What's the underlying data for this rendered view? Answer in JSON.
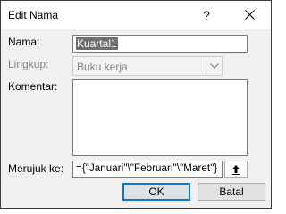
{
  "window": {
    "title": "Edit Nama",
    "help_label": "?"
  },
  "form": {
    "name_label": "Nama:",
    "name_value": "Kuartal1",
    "scope_label": "Lingkup:",
    "scope_value": "Buku kerja",
    "comment_label": "Komentar:",
    "comment_value": "",
    "refers_label": "Merujuk ke:",
    "refers_value": "={\"Januari\"\\\"Februari\"\\\"Maret\"}"
  },
  "buttons": {
    "ok_label": "OK",
    "cancel_label": "Batal"
  },
  "icons": {
    "close": "close-icon",
    "dropdown": "chevron-down-icon",
    "collapse": "collapse-dialog-icon"
  },
  "colors": {
    "focus_border": "#0078d7",
    "selection": "#6f6f6f",
    "disabled_text": "#838383"
  }
}
